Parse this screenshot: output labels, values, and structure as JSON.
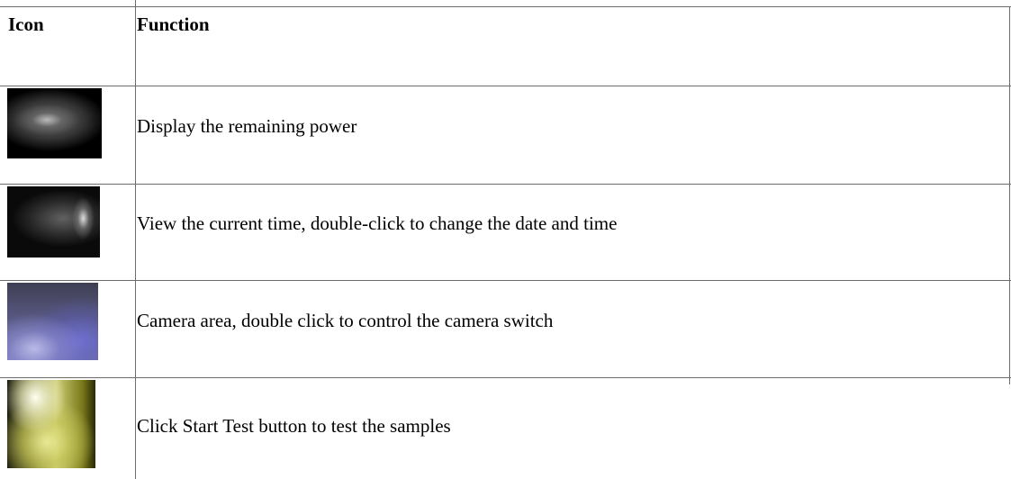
{
  "table": {
    "header": {
      "icon": "Icon",
      "function": "Function"
    },
    "rows": [
      {
        "icon": "battery-icon",
        "function": "Display the remaining power"
      },
      {
        "icon": "clock-icon",
        "function": "View the current time, double-click to change the date and time"
      },
      {
        "icon": "camera-icon",
        "function": "Camera area, double click to control the camera switch"
      },
      {
        "icon": "start-test-icon",
        "function": "Click Start Test button to test the samples"
      }
    ]
  },
  "colors": {
    "border": "#6b6b6b",
    "text": "#000000",
    "background": "#ffffff"
  }
}
